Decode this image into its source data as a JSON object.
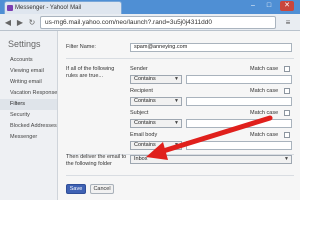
{
  "browser": {
    "tab_title": "Messenger - Yahoo! Mail",
    "url": "us-mg6.mail.yahoo.com/neo/launch?.rand=3u5j0j4311dd0",
    "minimize": "–",
    "maximize": "□",
    "close": "✕",
    "back": "◀",
    "forward": "▶",
    "refresh": "↻",
    "menu": "≡"
  },
  "settings": {
    "title": "Settings",
    "menu": [
      {
        "label": "Accounts"
      },
      {
        "label": "Viewing email"
      },
      {
        "label": "Writing email"
      },
      {
        "label": "Vacation Response"
      },
      {
        "label": "Filters",
        "active": true
      },
      {
        "label": "Security"
      },
      {
        "label": "Blocked Addresses"
      },
      {
        "label": "Messenger"
      }
    ]
  },
  "filter": {
    "name_label": "Filter Name:",
    "name_value": "spam@anneying.com",
    "rules_label": "If all of the following rules are true...",
    "match_case": "Match case",
    "rules": [
      {
        "field": "Sender",
        "operator": "Contains",
        "value": ""
      },
      {
        "field": "Recipient",
        "operator": "Contains",
        "value": ""
      },
      {
        "field": "Subject",
        "operator": "Contains",
        "value": ""
      },
      {
        "field": "Email body",
        "operator": "Contains",
        "value": ""
      }
    ],
    "deliver_label": "Then deliver the email to the following folder",
    "folder_value": "Inbox",
    "save": "Save",
    "cancel": "Cancel"
  },
  "colors": {
    "annotation_arrow": "#e0201c",
    "save_button": "#3f62b4",
    "chrome": "#4f8fd4"
  }
}
